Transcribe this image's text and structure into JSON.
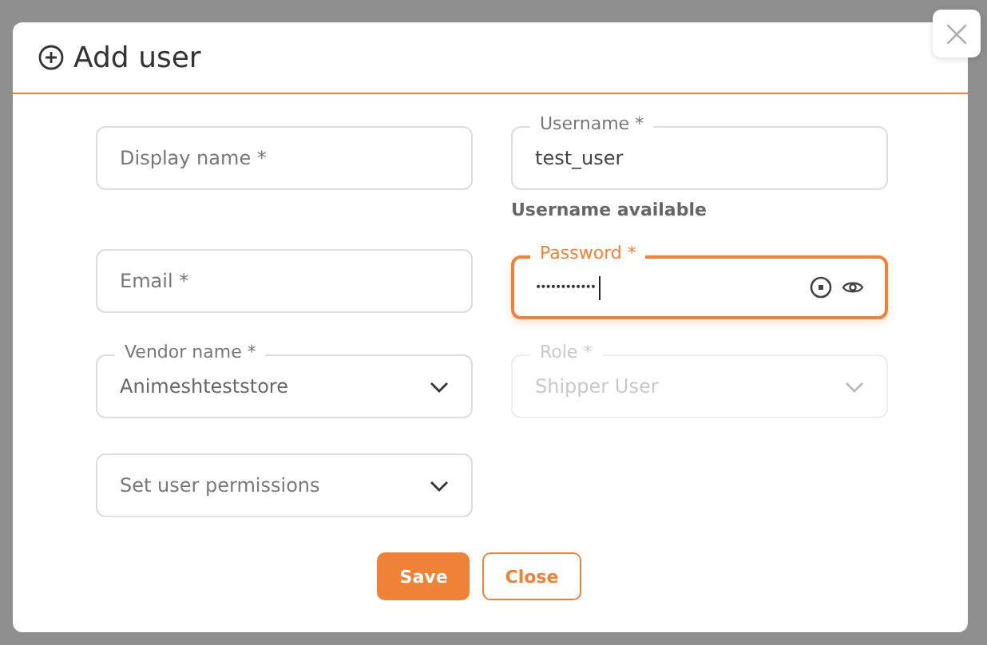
{
  "dialog": {
    "title": "Add user",
    "close_icon": "×"
  },
  "fields": [
    {
      "kind": "text",
      "placeholder": "Display name *",
      "focused": false,
      "disabled": false
    },
    {
      "kind": "text",
      "label": "Username *",
      "value": "test_user",
      "focused": false,
      "disabled": false,
      "helper": "Username available"
    },
    {
      "kind": "text",
      "placeholder": "Email *",
      "focused": false,
      "disabled": false
    },
    {
      "kind": "password",
      "label": "Password *",
      "value": "••••••••••••",
      "focused": true,
      "disabled": false
    },
    {
      "kind": "select",
      "label": "Vendor name *",
      "value": "Animeshteststore",
      "focused": false,
      "disabled": false
    },
    {
      "kind": "select",
      "label": "Role *",
      "value": "Shipper User",
      "focused": false,
      "disabled": true
    },
    {
      "kind": "select",
      "placeholder": "Set user permissions",
      "focused": false,
      "disabled": false
    }
  ],
  "buttons": [
    {
      "label": "Save",
      "kind": "primary"
    },
    {
      "label": "Close",
      "kind": "outline"
    }
  ]
}
